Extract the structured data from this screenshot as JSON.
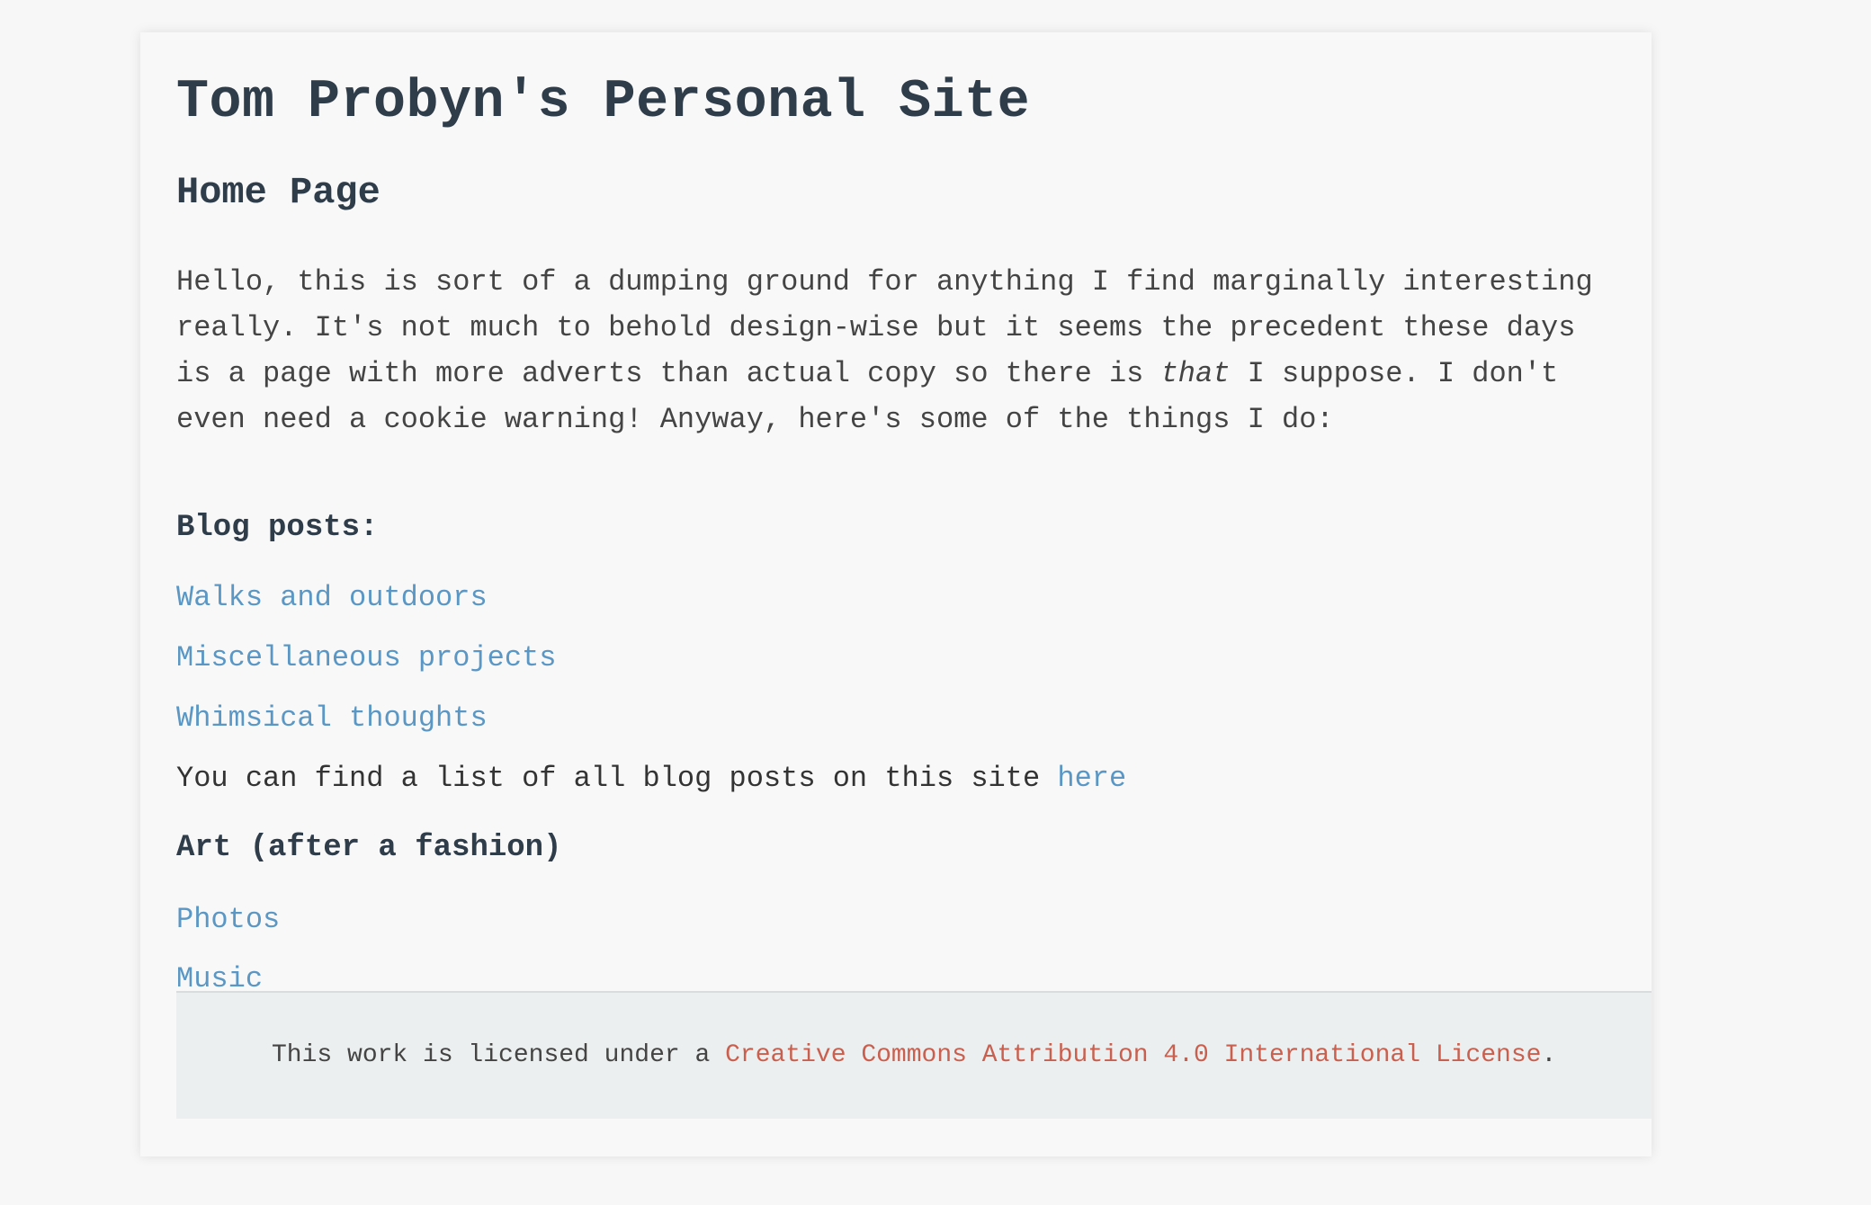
{
  "site_title": "Tom Probyn's Personal Site",
  "page_title": "Home Page",
  "intro": {
    "before_em": "Hello, this is sort of a dumping ground for anything I find marginally interesting really. It's not much to behold design-wise but it seems the precedent these days is a page with more adverts than actual copy so there is ",
    "em": "that",
    "after_em": " I suppose. I don't even need a cookie warning! Anyway, here's some of the things I do:"
  },
  "blog": {
    "heading": "Blog posts:",
    "links": [
      "Walks and outdoors",
      "Miscellaneous projects",
      "Whimsical thoughts"
    ],
    "all_posts_text": "You can find a list of all blog posts on this site ",
    "all_posts_link": "here"
  },
  "art": {
    "heading": "Art (after a fashion)",
    "links": [
      "Photos",
      "Music"
    ]
  },
  "footer": {
    "text_before": "This work is licensed under a ",
    "license_link": "Creative Commons Attribution 4.0 International License",
    "text_after": "."
  },
  "colors": {
    "background": "#f7f7f7",
    "heading": "#2f3c4a",
    "link": "#5b97c4",
    "footer_link": "#c9604f",
    "footer_bg": "#ecefef"
  }
}
